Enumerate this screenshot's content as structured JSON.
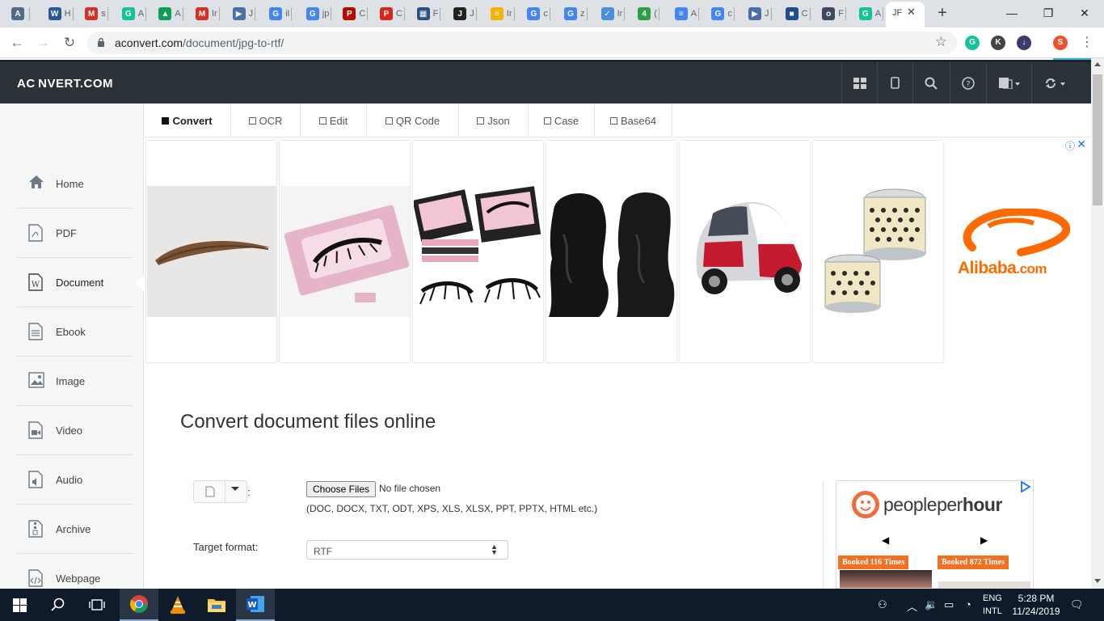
{
  "browser": {
    "tabs": [
      {
        "letter": "A",
        "color": "#4f6b8a"
      },
      {
        "letter": "W",
        "color": "#2b5797",
        "text": "H"
      },
      {
        "letter": "M",
        "color": "#d93025",
        "text": "s"
      },
      {
        "letter": "G",
        "color": "#15c39a",
        "text": "A"
      },
      {
        "letter": "▲",
        "color": "#0f9d58",
        "text": "A"
      },
      {
        "letter": "M",
        "color": "#d93025",
        "text": "Ir"
      },
      {
        "letter": "▶",
        "color": "#4a6fa5",
        "text": "J"
      },
      {
        "letter": "G",
        "color": "#4285f4",
        "text": "il"
      },
      {
        "letter": "G",
        "color": "#4285f4",
        "text": "jp"
      },
      {
        "letter": "P",
        "color": "#b30b00",
        "text": "C"
      },
      {
        "letter": "P",
        "color": "#d8261d",
        "text": "C"
      },
      {
        "letter": "▦",
        "color": "#2b4f7e",
        "text": "F"
      },
      {
        "letter": "J",
        "color": "#222222",
        "text": "J"
      },
      {
        "letter": "≡",
        "color": "#f4b400",
        "text": "Ir"
      },
      {
        "letter": "G",
        "color": "#4285f4",
        "text": "c"
      },
      {
        "letter": "G",
        "color": "#4285f4",
        "text": "z"
      },
      {
        "letter": "✓",
        "color": "#4a90d9",
        "text": "Ir"
      },
      {
        "letter": "4",
        "color": "#2e9e48",
        "text": "("
      },
      {
        "letter": "≡",
        "color": "#4285f4",
        "text": "A"
      },
      {
        "letter": "G",
        "color": "#4285f4",
        "text": "c"
      },
      {
        "letter": "▶",
        "color": "#4a6fa5",
        "text": "J"
      },
      {
        "letter": "■",
        "color": "#1f4e8c",
        "text": "C"
      },
      {
        "letter": "o",
        "color": "#3c4a5c",
        "text": "F"
      },
      {
        "letter": "G",
        "color": "#15c39a",
        "text": "A"
      }
    ],
    "active_tab_label": "JF",
    "url_domain": "aconvert.com",
    "url_path": "/document/jpg-to-rtf/",
    "extensions": [
      {
        "letter": "G",
        "color": "#15c39a"
      },
      {
        "letter": "K",
        "color": "#444444"
      },
      {
        "letter": "↓",
        "color": "#3b3b6d"
      },
      {
        "letter": "S",
        "color": "#e8542c"
      }
    ]
  },
  "site": {
    "logo": "AC NVERT.COM",
    "header_icons": [
      "grid-icon",
      "mobile-icon",
      "search-icon",
      "help-icon",
      "language-icon",
      "refresh-icon"
    ]
  },
  "sidebar": {
    "items": [
      {
        "label": "Home",
        "icon": "home-icon"
      },
      {
        "label": "PDF",
        "icon": "pdf-icon"
      },
      {
        "label": "Document",
        "icon": "document-icon",
        "active": true
      },
      {
        "label": "Ebook",
        "icon": "ebook-icon"
      },
      {
        "label": "Image",
        "icon": "image-icon"
      },
      {
        "label": "Video",
        "icon": "video-icon"
      },
      {
        "label": "Audio",
        "icon": "audio-icon"
      },
      {
        "label": "Archive",
        "icon": "archive-icon"
      },
      {
        "label": "Webpage",
        "icon": "webpage-icon"
      }
    ]
  },
  "tabs": [
    {
      "label": "Convert",
      "active": true
    },
    {
      "label": "OCR"
    },
    {
      "label": "Edit"
    },
    {
      "label": "QR Code"
    },
    {
      "label": "Json"
    },
    {
      "label": "Case"
    },
    {
      "label": "Base64"
    }
  ],
  "ads": {
    "brand": "Alibaba",
    "brand_suffix": ".com"
  },
  "main": {
    "title": "Convert document files online",
    "colon": ":",
    "choose_files": "Choose Files",
    "no_file": "No file chosen",
    "formats": "(DOC, DOCX, TXT, ODT, XPS, XLS, XLSX, PPT, PPTX, HTML etc.)",
    "target_label": "Target format:",
    "target_value": "RTF"
  },
  "side_ad": {
    "name_a": "people",
    "name_b": "per",
    "name_c": "hour",
    "prev": "◀",
    "next": "▶",
    "booked_1": "Booked 116 Times",
    "booked_2": "Booked 872 Times"
  },
  "taskbar": {
    "lang_1": "ENG",
    "lang_2": "INTL",
    "time": "5:28 PM",
    "date": "11/24/2019"
  }
}
